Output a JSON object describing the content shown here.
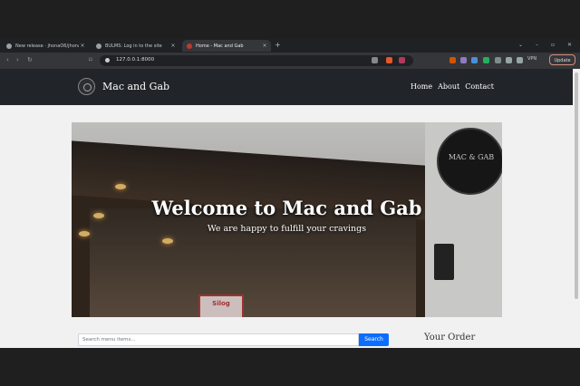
{
  "tabs": [
    {
      "label": "New release · jhonaO6/jhona",
      "icon": "github-icon"
    },
    {
      "label": "BULMS: Log in to the site",
      "icon": "gear-icon"
    },
    {
      "label": "Home - Mac and Gab",
      "icon": "site-icon"
    }
  ],
  "address": {
    "url": "127.0.0.1:8000"
  },
  "browser": {
    "vpn_label": "VPN",
    "update_label": "Update"
  },
  "site": {
    "brand": "Mac and Gab",
    "nav": [
      "Home",
      "About",
      "Contact"
    ]
  },
  "hero": {
    "title": "Welcome to Mac and Gab",
    "subtitle": "We are happy to fulfill your cravings",
    "badge_text": "MAC & GAB",
    "sign_text": "Silog"
  },
  "search": {
    "placeholder": "Search menu items...",
    "button": "Search"
  },
  "order": {
    "title": "Your Order"
  },
  "colors": {
    "navbar": "#212529",
    "accent": "#0d6efd"
  }
}
